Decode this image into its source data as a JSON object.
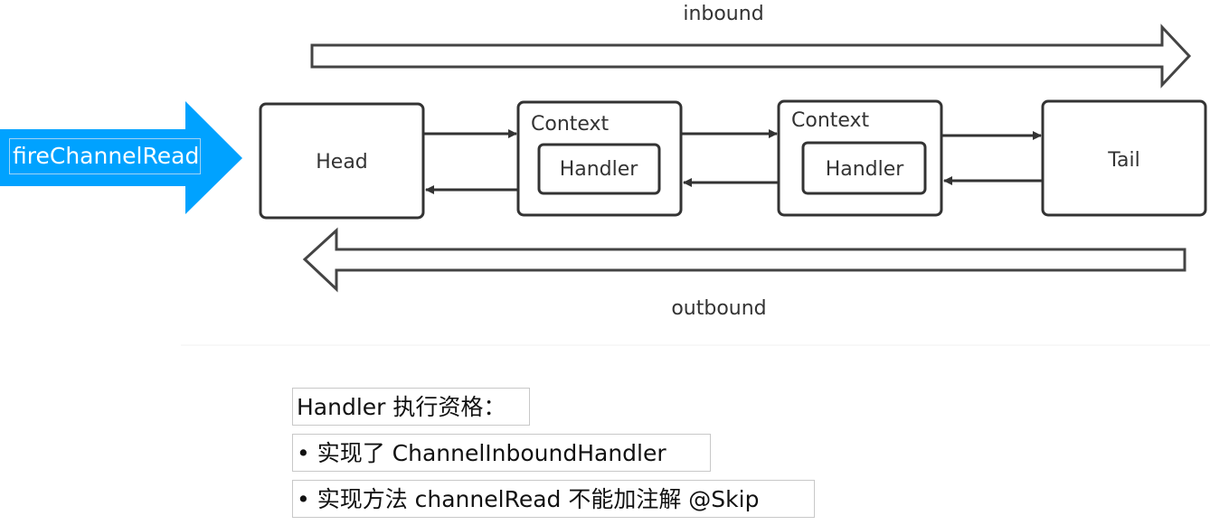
{
  "diagram": {
    "trigger_label": "fireChannelRead",
    "inbound_label": "inbound",
    "outbound_label": "outbound",
    "nodes": [
      {
        "label": "Head"
      },
      {
        "label": "Context",
        "inner": "Handler"
      },
      {
        "label": "Context",
        "inner": "Handler"
      },
      {
        "label": "Tail"
      }
    ],
    "colors": {
      "trigger": "#00a2ff",
      "stroke": "#333333"
    }
  },
  "notes": {
    "title": "Handler 执行资格：",
    "items": [
      "•  实现了 ChannelInboundHandler",
      "•  实现方法 channelRead 不能加注解 @Skip"
    ]
  }
}
